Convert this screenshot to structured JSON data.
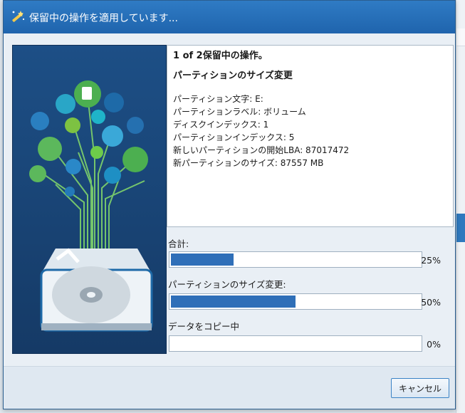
{
  "dialog": {
    "title": "保留中の操作を適用しています...",
    "title_icon": "wand-icon"
  },
  "info": {
    "heading": "1 of 2保留中の操作。",
    "operation": "パーティションのサイズ変更",
    "details": [
      "パーティション文字: E:",
      "パーティションラベル: ボリューム",
      "ディスクインデックス: 1",
      "パーティションインデックス: 5",
      "新しいパーティションの開始LBA: 87017472",
      "新パーティションのサイズ: 87557 MB"
    ]
  },
  "progress": [
    {
      "label": "合計:",
      "value": 25,
      "percent_text": "25%"
    },
    {
      "label": "パーティションのサイズ変更:",
      "value": 50,
      "percent_text": "50%"
    },
    {
      "label": "データをコピー中",
      "value": 0,
      "percent_text": "0%"
    }
  ],
  "buttons": {
    "cancel": "キャンセル"
  },
  "colors": {
    "titlebar": "#2f7bc4",
    "progress_fill": "#2f6fb8",
    "illustration_bg": "#1d4f86"
  }
}
